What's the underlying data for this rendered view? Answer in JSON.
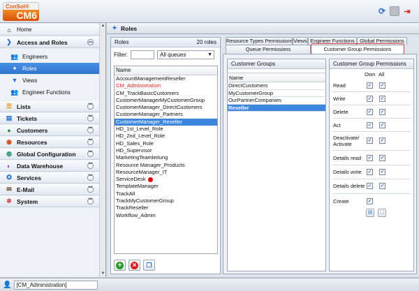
{
  "app": {
    "logo_top": "ConSol®",
    "logo_bottom": "CM6"
  },
  "sidebar": {
    "home": "Home",
    "access_and_roles": "Access and Roles",
    "access_items": [
      {
        "label": "Engineers",
        "icon": "engineers-icon"
      },
      {
        "label": "Roles",
        "icon": "roles-icon",
        "selected": true
      },
      {
        "label": "Views",
        "icon": "funnel-icon"
      },
      {
        "label": "Engineer Functions",
        "icon": "engineer-functions-icon"
      }
    ],
    "groups": [
      {
        "label": "Lists",
        "icon": "lists-icon"
      },
      {
        "label": "Tickets",
        "icon": "tickets-icon"
      },
      {
        "label": "Customers",
        "icon": "customers-icon"
      },
      {
        "label": "Resources",
        "icon": "resources-icon"
      },
      {
        "label": "Global Configuration",
        "icon": "globe-icon"
      },
      {
        "label": "Data Warehouse",
        "icon": "data-warehouse-icon"
      },
      {
        "label": "Services",
        "icon": "services-icon"
      },
      {
        "label": "E-Mail",
        "icon": "email-icon"
      },
      {
        "label": "System",
        "icon": "system-icon"
      }
    ]
  },
  "main": {
    "title": "Roles"
  },
  "roles_panel": {
    "title": "Roles",
    "count": "20 roles",
    "filter_label": "Filter:",
    "filter_value": "",
    "queue_select": "All queues",
    "column_header": "Name",
    "roles": [
      {
        "name": "AccountManagementReseller"
      },
      {
        "name": "CM_Administration",
        "red": true
      },
      {
        "name": "CM_TrackBasicCustomers"
      },
      {
        "name": "CustomerManagerMyCustomerGroup"
      },
      {
        "name": "CustomerManager_DirectCustomers"
      },
      {
        "name": "CustomerManager_Partners"
      },
      {
        "name": "CustomerManager_Reseller",
        "selected": true
      },
      {
        "name": "HD_1st_Level_Role"
      },
      {
        "name": "HD_2nd_Level_Role"
      },
      {
        "name": "HD_Sales_Role"
      },
      {
        "name": "HD_Supervisor"
      },
      {
        "name": "MarketingTeamleitung"
      },
      {
        "name": "Resource Manager_Products"
      },
      {
        "name": "ResourceManager_IT"
      },
      {
        "name": "ServiceDesk",
        "dot": true
      },
      {
        "name": "TemplateManager"
      },
      {
        "name": "TrackAll"
      },
      {
        "name": "TrackMyCustomerGroup"
      },
      {
        "name": "TrackReseller"
      },
      {
        "name": "Workflow_Admin"
      }
    ]
  },
  "tabs": {
    "row1": [
      "Resource Types Permissions",
      "Views",
      "Engineer Functions",
      "Global Permissions"
    ],
    "row2": [
      "Queue Permissions",
      "Customer Group Permissions"
    ]
  },
  "customer_groups": {
    "title": "Customer Groups",
    "column_header": "Name",
    "items": [
      {
        "name": "DirectCustomers"
      },
      {
        "name": "MyCustomerGroup"
      },
      {
        "name": "OurPartnerCompanies"
      },
      {
        "name": "Reseller",
        "selected": true
      }
    ]
  },
  "permissions": {
    "title": "Customer Group Permissions",
    "col_own": "Own",
    "col_all": "All",
    "rows": [
      {
        "label": "Read",
        "own": true,
        "all": true
      },
      {
        "label": "Write",
        "own": true,
        "all": true
      },
      {
        "label": "Delete",
        "own": true,
        "all": true
      },
      {
        "label": "Act",
        "own": true,
        "all": true
      },
      {
        "label": "Deactivate/",
        "label2": "Activate",
        "own": true,
        "all": true
      },
      {
        "label": "Details read",
        "own": true,
        "all": true
      },
      {
        "label": "Details write",
        "own": true,
        "all": true
      },
      {
        "label": "Details delete",
        "own": true,
        "all": true
      }
    ],
    "create_label": "Create",
    "create_checked": true
  },
  "statusbar": {
    "user": "[CM_Administration]"
  }
}
